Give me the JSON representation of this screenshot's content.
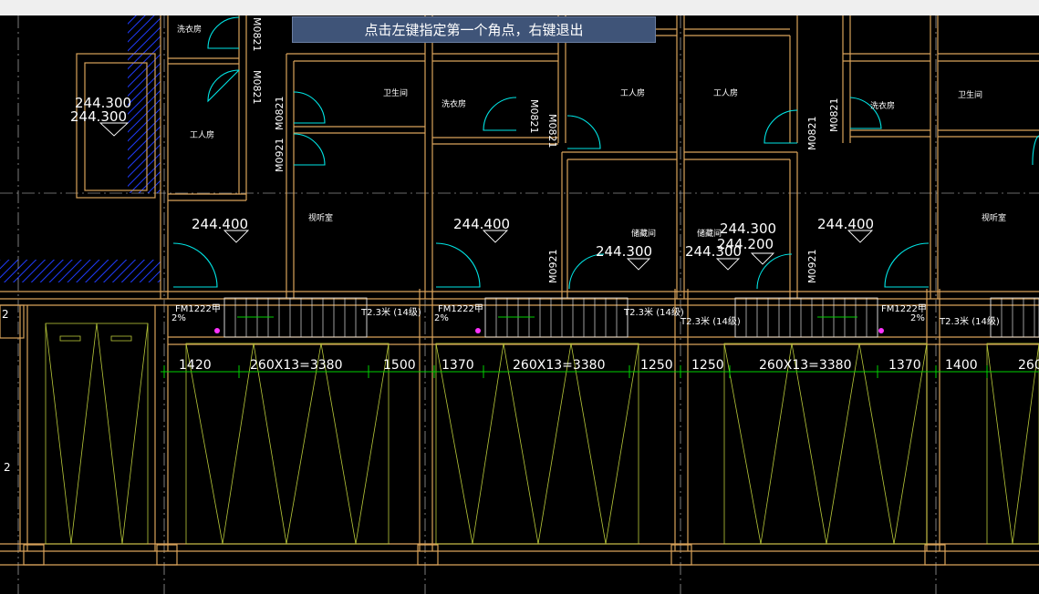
{
  "prompt": "点击左键指定第一个角点，右键退出",
  "colors": {
    "wall": "#d9a35b",
    "door": "#00e5e5",
    "dim": "#00d000",
    "hatch": "#1f3cff",
    "text": "#ffffff",
    "ramp": "#b9c93a",
    "mark": "#ff33ff"
  },
  "rooms": [
    {
      "label": "洗衣房"
    },
    {
      "label": "工人房"
    },
    {
      "label": "卫生间"
    },
    {
      "label": "洗衣房"
    },
    {
      "label": "工人房"
    },
    {
      "label": "工人房"
    },
    {
      "label": "洗衣房"
    },
    {
      "label": "卫生间"
    },
    {
      "label": "视听室"
    },
    {
      "label": "储藏间"
    },
    {
      "label": "储藏间"
    },
    {
      "label": "视听室"
    }
  ],
  "elevations": [
    {
      "value": "244.300"
    },
    {
      "value": "244.300"
    },
    {
      "value": "244.400"
    },
    {
      "value": "244.400"
    },
    {
      "value": "244.300"
    },
    {
      "value": "244.300"
    },
    {
      "value": "244.300"
    },
    {
      "value": "244.200"
    },
    {
      "value": "244.400"
    }
  ],
  "doors": [
    {
      "code": "M0821"
    },
    {
      "code": "M0821"
    },
    {
      "code": "M0821"
    },
    {
      "code": "M0921"
    },
    {
      "code": "M0821"
    },
    {
      "code": "M0821"
    },
    {
      "code": "M0921"
    },
    {
      "code": "M0821"
    },
    {
      "code": "M0921"
    },
    {
      "code": "M0821"
    }
  ],
  "fire_doors": [
    {
      "code": "FM1222甲"
    },
    {
      "code": "FM1222甲"
    },
    {
      "code": "FM1222甲"
    }
  ],
  "slopes": [
    {
      "value": "2%"
    },
    {
      "value": "2%"
    },
    {
      "value": "2%"
    }
  ],
  "stair_notes": [
    {
      "text": "T2.3米 (14级)"
    },
    {
      "text": "T2.3米 (14级)"
    },
    {
      "text": "T2.3米 (14级)"
    },
    {
      "text": "T2.3米 (14级)"
    }
  ],
  "dimensions": [
    {
      "text": "1420"
    },
    {
      "text": "260X13=3380"
    },
    {
      "text": "1500"
    },
    {
      "text": "1370"
    },
    {
      "text": "260X13=3380"
    },
    {
      "text": "1250"
    },
    {
      "text": "1250"
    },
    {
      "text": "260X13=3380"
    },
    {
      "text": "1370"
    },
    {
      "text": "1400"
    },
    {
      "text": "260"
    }
  ],
  "edge_labels": [
    {
      "text": "2"
    },
    {
      "text": "2"
    }
  ]
}
